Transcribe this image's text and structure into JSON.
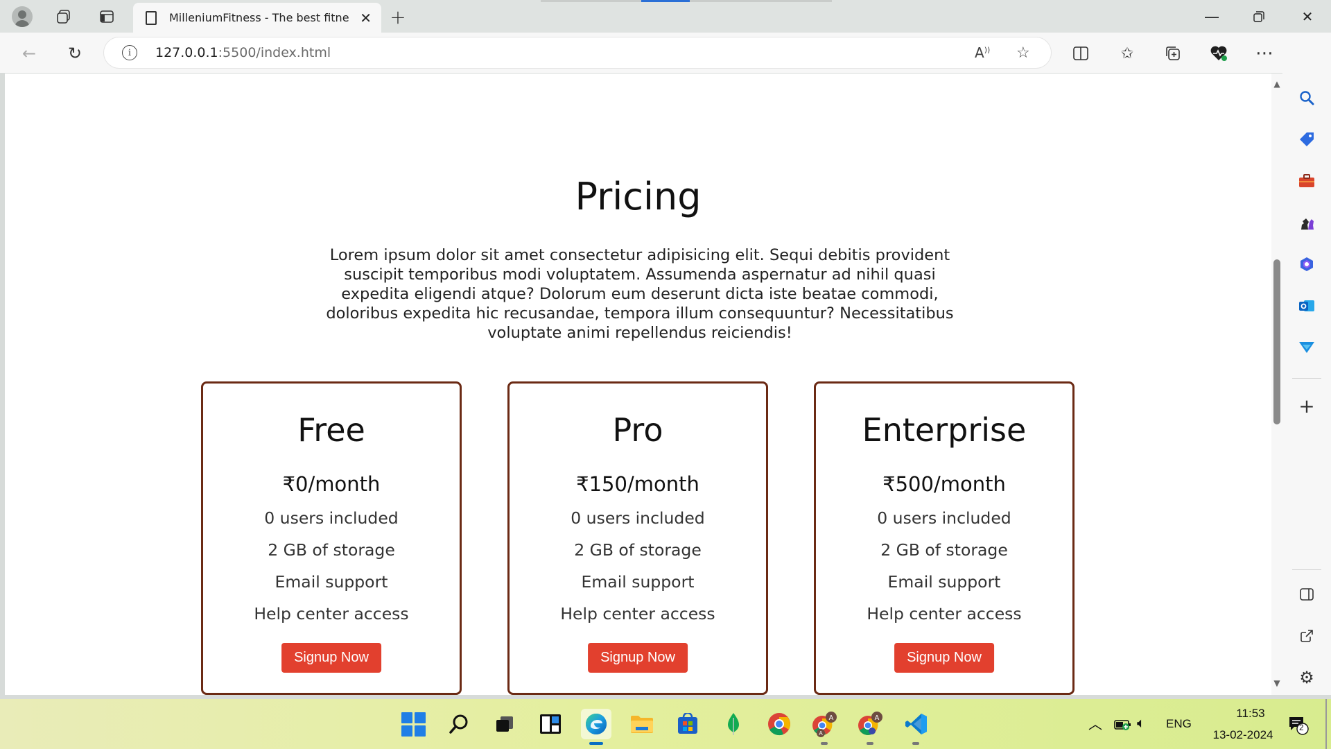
{
  "browser": {
    "tab_title": "MilleniumFitness - The best fitne",
    "url_host": "127.0.0.1",
    "url_rest": ":5500/index.html"
  },
  "pricing": {
    "title": "Pricing",
    "description": "Lorem ipsum dolor sit amet consectetur adipisicing elit. Sequi debitis provident suscipit temporibus modi voluptatem. Assumenda aspernatur ad nihil quasi expedita eligendi atque? Dolorum eum deserunt dicta iste beatae commodi, doloribus expedita hic recusandae, tempora illum consequuntur? Necessitatibus voluptate animi repellendus reiciendis!",
    "plans": [
      {
        "name": "Free",
        "price": "₹0/month",
        "features": [
          "0 users included",
          "2 GB of storage",
          "Email support",
          "Help center access"
        ],
        "button": "Signup Now"
      },
      {
        "name": "Pro",
        "price": "₹150/month",
        "features": [
          "0 users included",
          "2 GB of storage",
          "Email support",
          "Help center access"
        ],
        "button": "Signup Now"
      },
      {
        "name": "Enterprise",
        "price": "₹500/month",
        "features": [
          "0 users included",
          "2 GB of storage",
          "Email support",
          "Help center access"
        ],
        "button": "Signup Now"
      }
    ]
  },
  "taskbar": {
    "language": "ENG",
    "time": "11:53",
    "date": "13-02-2024",
    "notification_count": "2"
  },
  "colors": {
    "card_border": "#6b2a14",
    "button_bg": "#e2402e",
    "edge_accent": "#0a6fc2"
  }
}
